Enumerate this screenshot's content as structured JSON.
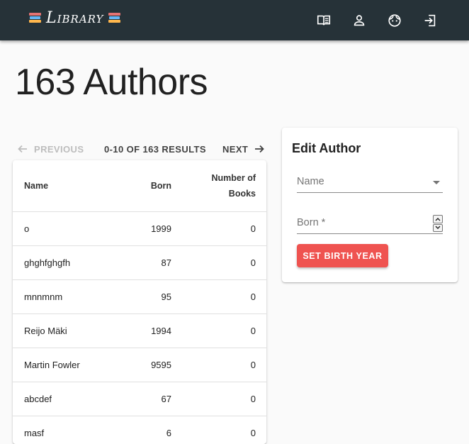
{
  "appbar": {
    "brand": "Library",
    "icons": [
      "books-icon",
      "book-open-icon",
      "person-icon",
      "face-icon",
      "login-icon"
    ]
  },
  "page": {
    "title": "163 Authors"
  },
  "pager": {
    "previous_label": "PREVIOUS",
    "info": "0-10 OF 163 RESULTS",
    "next_label": "NEXT"
  },
  "table": {
    "headers": {
      "name": "Name",
      "born": "Born",
      "books_line1": "Number of",
      "books_line2": "Books"
    },
    "rows": [
      {
        "name": "o",
        "born": "1999",
        "books": "0"
      },
      {
        "name": "ghghfghgfh",
        "born": "87",
        "books": "0"
      },
      {
        "name": "mnnmnm",
        "born": "95",
        "books": "0"
      },
      {
        "name": "Reijo Mäki",
        "born": "1994",
        "books": "0"
      },
      {
        "name": "Martin Fowler",
        "born": "9595",
        "books": "0"
      },
      {
        "name": "abcdef",
        "born": "67",
        "books": "0"
      },
      {
        "name": "masf",
        "born": "6",
        "books": "0"
      }
    ]
  },
  "edit": {
    "title": "Edit Author",
    "name_label": "Name",
    "born_label": "Born *",
    "submit_label": "SET BIRTH YEAR"
  },
  "colors": {
    "appbar": "#263238",
    "accent": "#ef5350"
  }
}
